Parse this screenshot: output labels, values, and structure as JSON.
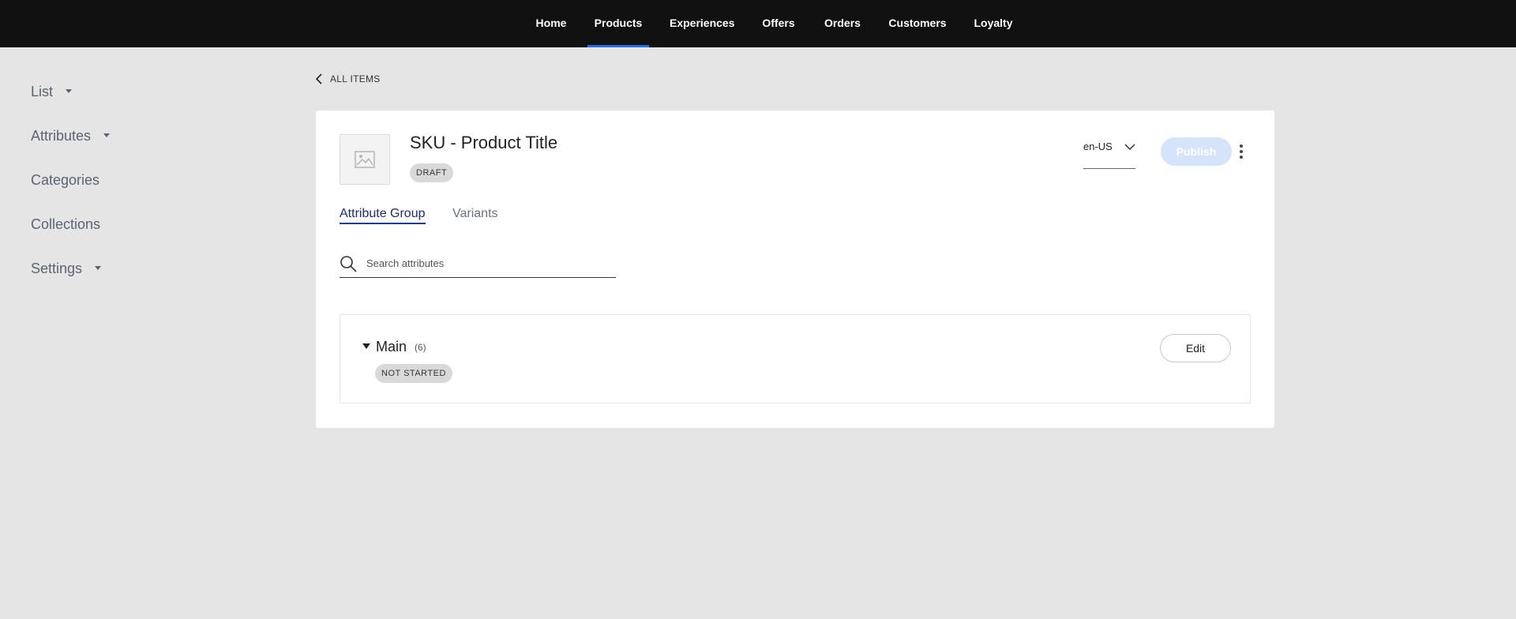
{
  "topnav": {
    "items": [
      {
        "label": "Home"
      },
      {
        "label": "Products",
        "active": true
      },
      {
        "label": "Experiences"
      },
      {
        "label": "Offers"
      },
      {
        "label": "Orders"
      },
      {
        "label": "Customers"
      },
      {
        "label": "Loyalty"
      }
    ],
    "active_color": "#1f6feb"
  },
  "sidebar": {
    "items": [
      {
        "label": "List",
        "has_dropdown": true
      },
      {
        "label": "Attributes",
        "has_dropdown": true
      },
      {
        "label": "Categories",
        "has_dropdown": false
      },
      {
        "label": "Collections",
        "has_dropdown": false
      },
      {
        "label": "Settings",
        "has_dropdown": true
      }
    ]
  },
  "back_link": {
    "label": "ALL ITEMS",
    "icon": "chevron-left-icon"
  },
  "product": {
    "title": "SKU - Product Title",
    "status_badge": "DRAFT",
    "image_icon": "image-placeholder-icon"
  },
  "locale": {
    "value": "en-US",
    "icon": "chevron-down-icon"
  },
  "actions": {
    "publish_label": "Publish",
    "more_icon": "more-vertical-icon"
  },
  "tabs": [
    {
      "label": "Attribute Group",
      "active": true
    },
    {
      "label": "Variants",
      "active": false
    }
  ],
  "search": {
    "placeholder": "Search attributes",
    "value": "",
    "icon": "search-icon"
  },
  "attribute_group": {
    "name": "Main",
    "count": "(6)",
    "status": "NOT STARTED",
    "edit_label": "Edit"
  }
}
